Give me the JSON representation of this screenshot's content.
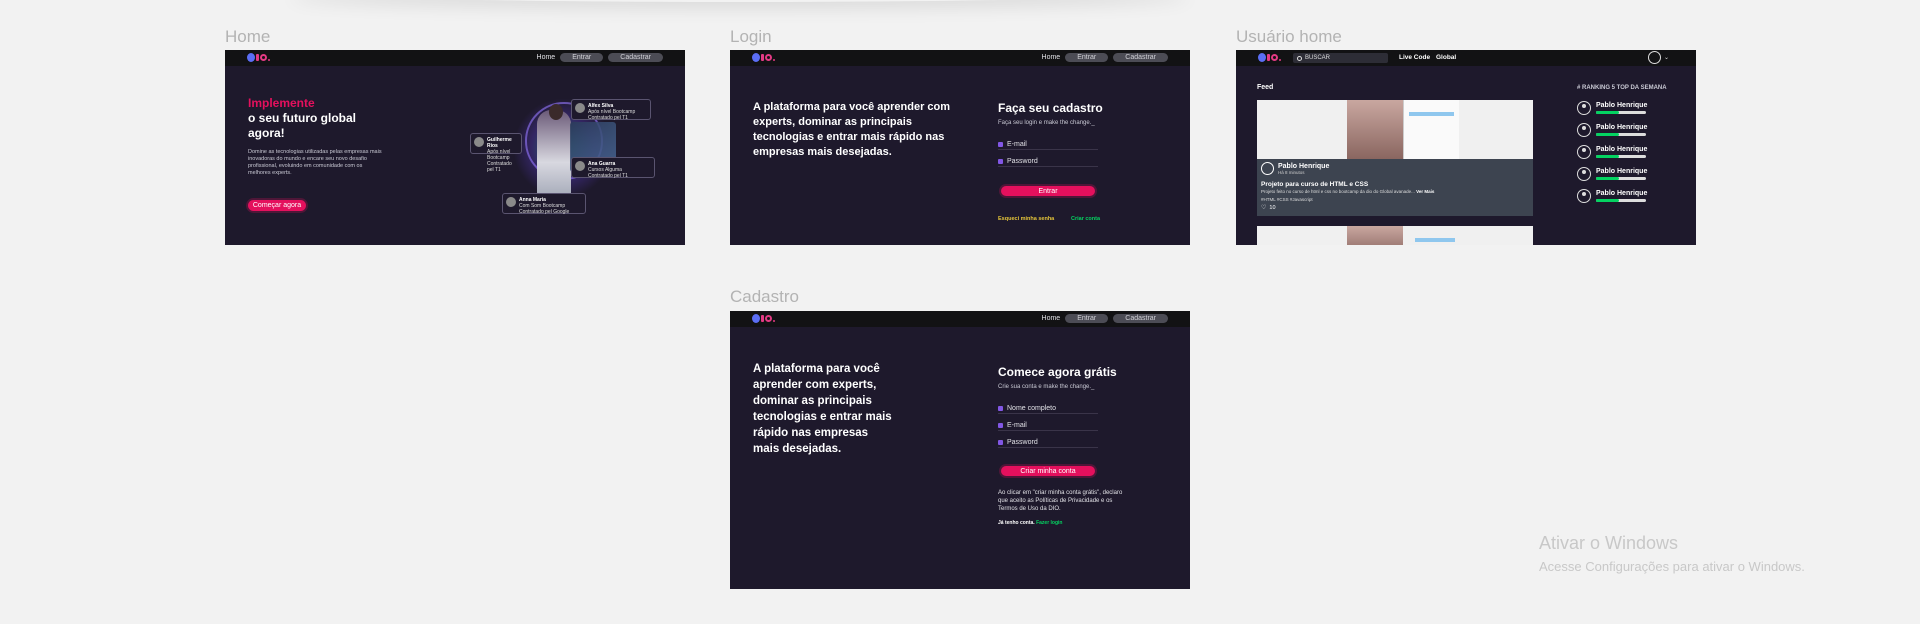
{
  "frames": {
    "home": {
      "label": "Home",
      "nav": {
        "home": "Home",
        "login": "Entrar",
        "signup": "Cadastrar"
      },
      "headline_accent": "Implemente",
      "headline_rest": "o seu futuro global agora!",
      "description": "Domine as tecnologias utilizadas pelas empresas mais inovadoras do mundo e encare seu novo desafio profissional, evoluindo em comunidade com os melhores experts.",
      "cta": "Começar agora",
      "cards": [
        {
          "name": "Alfex Silva",
          "text": "Após nível Bootcamp",
          "sub": "Contratado pel T1"
        },
        {
          "name": "Guilherme Rios",
          "text": "Após nível Bootcamp",
          "sub": "Contratado pel T1"
        },
        {
          "name": "Ana Guarra",
          "text": "Cursos Alguma",
          "sub": "Contratado pel T1"
        },
        {
          "name": "Anna Maria",
          "text": "Com Som Bootcamp",
          "sub": "Contratado pel Google"
        }
      ]
    },
    "login": {
      "label": "Login",
      "nav": {
        "home": "Home",
        "login": "Entrar",
        "signup": "Cadastrar"
      },
      "pitch": "A plataforma para você aprender com experts, dominar as principais tecnologias e entrar mais rápido nas empresas mais desejadas.",
      "title": "Faça seu cadastro",
      "subtitle": "Faça seu login e make the change._",
      "email_placeholder": "E-mail",
      "password_placeholder": "Password",
      "submit": "Entrar",
      "forgot": "Esqueci minha senha",
      "create": "Criar conta"
    },
    "user_home": {
      "label": "Usuário home",
      "search": "BUSCAR",
      "live_code": "Live Code",
      "global": "Global",
      "feed_title": "Feed",
      "post": {
        "author": "Pablo Henrique",
        "time": "Há 8 minutos",
        "title": "Projeto para curso de HTML e CSS",
        "text": "Projeto feito no curso de html e css no bootcamp da dio do Global avanade...",
        "see_more": "Ver Mais",
        "tags": "#HTML #CSS #Javascript",
        "likes": "10"
      },
      "ranking_title": "# RANKING 5 TOP DA SEMANA",
      "ranking": [
        {
          "name": "Pablo Henrique",
          "progress": 0.45
        },
        {
          "name": "Pablo Henrique",
          "progress": 0.45
        },
        {
          "name": "Pablo Henrique",
          "progress": 0.45
        },
        {
          "name": "Pablo Henrique",
          "progress": 0.45
        },
        {
          "name": "Pablo Henrique",
          "progress": 0.45
        }
      ]
    },
    "signup": {
      "label": "Cadastro",
      "nav": {
        "home": "Home",
        "login": "Entrar",
        "signup": "Cadastrar"
      },
      "pitch": "A plataforma para você aprender com experts, dominar as principais tecnologias e entrar mais rápido nas empresas mais desejadas.",
      "title": "Comece agora grátis",
      "subtitle": "Crie sua conta e make the change._",
      "name_placeholder": "Nome completo",
      "email_placeholder": "E-mail",
      "password_placeholder": "Password",
      "submit": "Criar minha conta",
      "terms": "Ao clicar em \"criar minha conta grátis\", declaro que aceito as Políticas de Privacidade e os Termos de Uso da DIO.",
      "have_account": "Já tenho conta.",
      "login_link": "Fazer login"
    }
  },
  "windows_watermark": {
    "title": "Ativar o Windows",
    "subtitle": "Acesse Configurações para ativar o Windows."
  },
  "colors": {
    "background": "#f2f2f2",
    "frame": "#1e192c",
    "navbar": "#121214",
    "accent_pink": "#e4105d",
    "accent_green": "#04d361",
    "accent_yellow": "#e5c53a"
  }
}
